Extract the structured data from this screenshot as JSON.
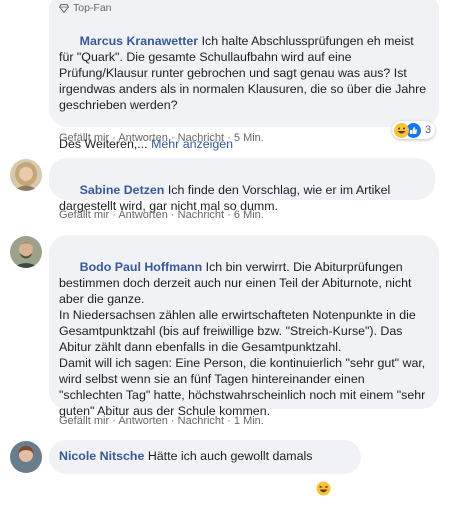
{
  "comments": [
    {
      "badge": "Top-Fan",
      "author": "Marcus Kranawetter",
      "text": "Ich halte Abschlussprüfungen eh meist für \"Quark\". Die gesamte Schullaufbahn wird auf eine Prüfung/Klausur runter gebrochen und sagt genau was aus? Ist irgendwas anders als in normalen Klausuren, die so über die Jahre geschrieben werden?",
      "text2": "Des Weiteren,...",
      "more": "Mehr anzeigen",
      "like": "Gefällt mir",
      "reply": "Antworten",
      "message": "Nachricht",
      "time": "5 Min.",
      "reaction_count": "3"
    },
    {
      "author": "Sabine Detzen",
      "text": "Ich finde den Vorschlag, wie er im Artikel dargestellt wird, gar nicht mal so dumm.",
      "like": "Gefällt mir",
      "reply": "Antworten",
      "message": "Nachricht",
      "time": "6 Min."
    },
    {
      "author": "Bodo Paul Hoffmann",
      "text": "Ich bin verwirrt. Die Abiturprüfungen bestimmen doch derzeit auch nur einen Teil der Abiturnote, nicht aber die ganze.\nIn Niedersachsen zählen alle erwirtschafteten Notenpunkte in die Gesamtpunktzahl (bis auf freiwillige bzw. \"Streich-Kurse\"). Das Abitur zählt dann ebenfalls in die Gesamtpunktzahl.\nDamit will ich sagen: Eine Person, die kontinuierlich \"sehr gut\" war, wird selbst wenn sie an fünf Tagen hintereinander einen \"schlechten Tag\" hatte, höchstwahrscheinlich noch mit einem \"sehr guten\" Abitur aus der Schule kommen.",
      "like": "Gefällt mir",
      "reply": "Antworten",
      "message": "Nachricht",
      "time": "1 Min."
    },
    {
      "author": "Nicole Nitsche",
      "text": "Hätte ich auch gewollt damals"
    }
  ],
  "colors": {
    "bubble": "#f0f2f5",
    "name": "#385898",
    "meta": "#65676b"
  }
}
